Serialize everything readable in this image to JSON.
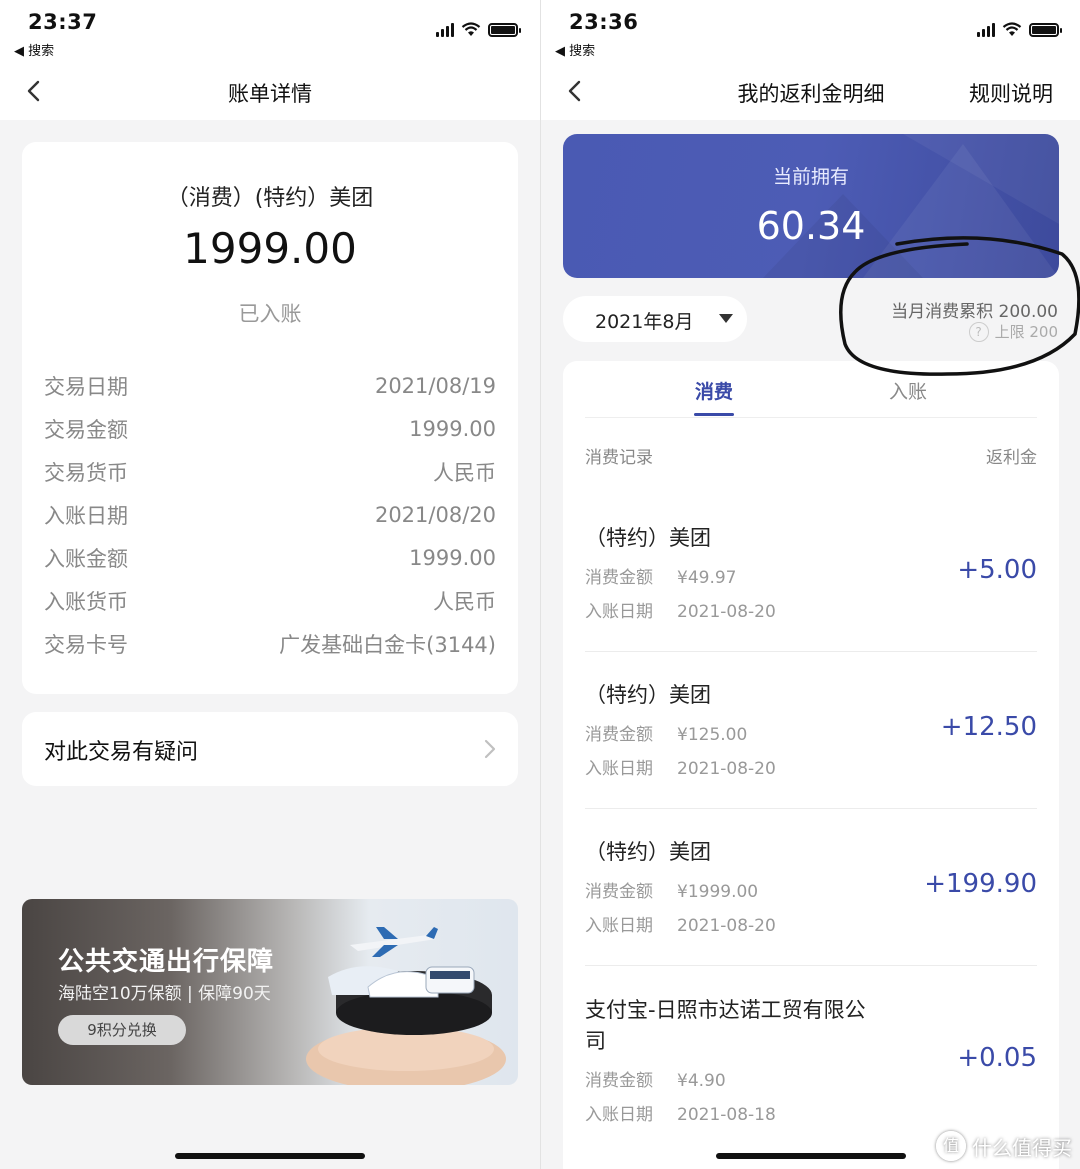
{
  "left": {
    "status": {
      "time": "23:37",
      "back_app": "◀ 搜索"
    },
    "nav": {
      "title": "账单详情"
    },
    "detail": {
      "merchant": "（消费）(特约）美团",
      "amount": "1999.00",
      "status": "已入账",
      "rows": [
        {
          "label": "交易日期",
          "value": "2021/08/19"
        },
        {
          "label": "交易金额",
          "value": "1999.00"
        },
        {
          "label": "交易货币",
          "value": "人民币"
        },
        {
          "label": "入账日期",
          "value": "2021/08/20"
        },
        {
          "label": "入账金额",
          "value": "1999.00"
        },
        {
          "label": "入账货币",
          "value": "人民币"
        },
        {
          "label": "交易卡号",
          "value": "广发基础白金卡(3144)"
        }
      ]
    },
    "question": {
      "label": "对此交易有疑问"
    },
    "banner": {
      "title": "公共交通出行保障",
      "subtitle": "海陆空10万保额 | 保障90天",
      "button": "9积分兑换"
    }
  },
  "right": {
    "status": {
      "time": "23:36",
      "back_app": "◀ 搜索"
    },
    "nav": {
      "title": "我的返利金明细",
      "action": "规则说明"
    },
    "balance": {
      "label": "当前拥有",
      "value": "60.34"
    },
    "month": "2021年8月",
    "accumulation": "当月消费累积 200.00",
    "limit": "上限 200",
    "help_icon": "?",
    "tabs": {
      "active": "消费",
      "inactive": "入账"
    },
    "list_header": {
      "left": "消费记录",
      "right": "返利金"
    },
    "amount_label": "消费金额",
    "date_label": "入账日期",
    "records": [
      {
        "title": "（特约）美团",
        "amount": "¥49.97",
        "date": "2021-08-20",
        "rebate": "+5.00"
      },
      {
        "title": "（特约）美团",
        "amount": "¥125.00",
        "date": "2021-08-20",
        "rebate": "+12.50"
      },
      {
        "title": "（特约）美团",
        "amount": "¥1999.00",
        "date": "2021-08-20",
        "rebate": "+199.90"
      },
      {
        "title": "支付宝-日照市达诺工贸有限公司",
        "amount": "¥4.90",
        "date": "2021-08-18",
        "rebate": "+0.05"
      }
    ],
    "watermark": {
      "logo": "值",
      "text": "什么值得买"
    }
  },
  "colors": {
    "accent": "#3a4aa8",
    "balance_card": "#4a5ab3",
    "page_bg": "#f4f4f5"
  }
}
